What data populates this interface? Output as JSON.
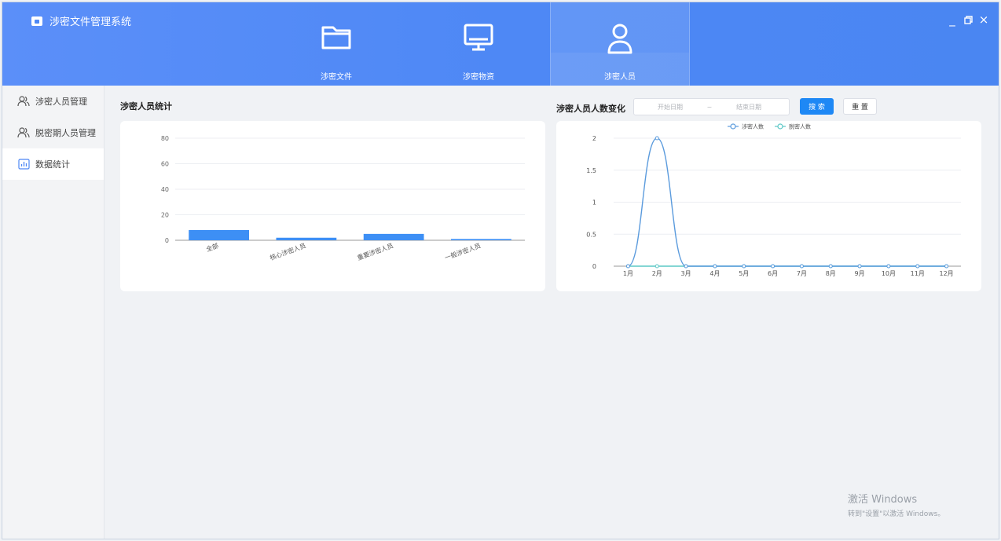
{
  "app": {
    "title": "涉密文件管理系统"
  },
  "nav": [
    {
      "label": "涉密文件",
      "icon": "folder-icon",
      "active": false
    },
    {
      "label": "涉密物资",
      "icon": "monitor-icon",
      "active": false
    },
    {
      "label": "涉密人员",
      "icon": "user-icon",
      "active": true
    }
  ],
  "window_controls": {
    "minimize": "_",
    "maximize": "□",
    "close": "×"
  },
  "sidebar": {
    "items": [
      {
        "label": "涉密人员管理",
        "icon": "users-icon",
        "active": false
      },
      {
        "label": "脱密期人员管理",
        "icon": "users-icon",
        "active": false
      },
      {
        "label": "数据统计",
        "icon": "bar-chart-icon",
        "active": true
      }
    ]
  },
  "stats_panel": {
    "title": "涉密人员统计"
  },
  "trend_panel": {
    "title": "涉密人员人数变化",
    "start_placeholder": "开始日期",
    "separator": "~",
    "end_placeholder": "结束日期",
    "search_label": "搜 索",
    "reset_label": "重 置"
  },
  "watermark": {
    "line1": "激活 Windows",
    "line2": "转到\"设置\"以激活 Windows。"
  },
  "colors": {
    "header": "#4e88f5",
    "bar": "#3d8ff5",
    "series1": "#5b9bdd",
    "series2": "#5cc8c6",
    "primary_button": "#1e88f5"
  },
  "chart_data": [
    {
      "type": "bar",
      "title": "",
      "categories": [
        "全部",
        "核心涉密人员",
        "重要涉密人员",
        "一般涉密人员"
      ],
      "values": [
        8,
        2,
        5,
        1
      ],
      "ylim": [
        0,
        80
      ],
      "yticks": [
        0,
        20,
        40,
        60,
        80
      ],
      "grid": true
    },
    {
      "type": "line",
      "title": "",
      "categories": [
        "1月",
        "2月",
        "3月",
        "4月",
        "5月",
        "6月",
        "7月",
        "8月",
        "9月",
        "10月",
        "11月",
        "12月"
      ],
      "series": [
        {
          "name": "涉密人数",
          "values": [
            0,
            2,
            0,
            0,
            0,
            0,
            0,
            0,
            0,
            0,
            0,
            0
          ]
        },
        {
          "name": "脱密人数",
          "values": [
            0,
            0,
            0,
            0,
            0,
            0,
            0,
            0,
            0,
            0,
            0,
            0
          ]
        }
      ],
      "ylim": [
        0,
        2
      ],
      "yticks": [
        0,
        0.5,
        1,
        1.5,
        2
      ],
      "grid": true,
      "legend": "top-center"
    }
  ]
}
